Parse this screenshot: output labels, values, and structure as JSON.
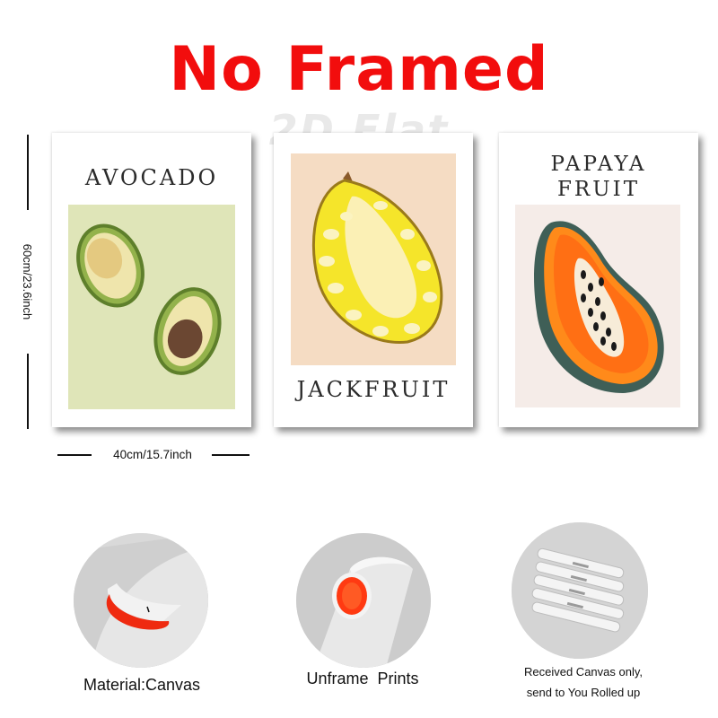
{
  "headline": "No Framed",
  "watermark": "2D Flat",
  "posters": [
    {
      "title": "AVOCADO"
    },
    {
      "title": "JACKFRUIT"
    },
    {
      "title_line1": "PAPAYA",
      "title_line2": "FRUIT"
    }
  ],
  "dimensions": {
    "height_label": "60cm/23.6inch",
    "width_label": "40cm/15.7inch"
  },
  "features": [
    {
      "caption": "Material:Canvas",
      "icon": "canvas-roll-photo"
    },
    {
      "caption": "Unframe  Prints",
      "icon": "canvas-tube-photo"
    },
    {
      "caption_line1": "Received Canvas only,",
      "caption_line2": "send to You Rolled up",
      "icon": "rolled-canvas-tubes-photo"
    }
  ],
  "colors": {
    "headline": "#f20d0d",
    "avocado_bg": "#dfe5b8",
    "jackfruit_bg": "#f5dcc3",
    "papaya_bg": "#f5ece8"
  }
}
